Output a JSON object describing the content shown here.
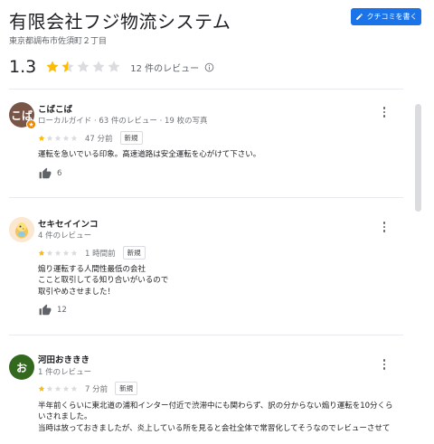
{
  "header": {
    "title": "有限会社フジ物流システム",
    "address": "東京都調布市佐須町２丁目",
    "write_review_label": "クチコミを書く",
    "average_rating": "1.3",
    "rating_value": 1.3,
    "rating_max": 5,
    "review_count_label": "12 件のレビュー"
  },
  "reviews": [
    {
      "avatar_text": "こば",
      "avatar_color": "#795548",
      "author": "こばこば",
      "meta": "ローカルガイド · 63 件のレビュー · 19 枚の写真",
      "stars": 1,
      "time": "47 分前",
      "badge": "新規",
      "text_lines": [
        "運転を急いでいる印象。高速道路は安全運転を心がけて下さい。"
      ],
      "likes": "6"
    },
    {
      "avatar_text": "",
      "avatar_color": "#fce8d0",
      "author": "セキセイインコ",
      "meta": "4 件のレビュー",
      "stars": 1,
      "time": "1 時間前",
      "badge": "新規",
      "text_lines": [
        "煽り運転する人間性最低の会社",
        "ここと取引してる知り合いがいるので",
        "取引やめさせました！"
      ],
      "likes": "12"
    },
    {
      "avatar_text": "お",
      "avatar_color": "#33691e",
      "author": "河田おききき",
      "meta": "1 件のレビュー",
      "stars": 1,
      "time": "7 分前",
      "badge": "新規",
      "text_lines": [
        "半年前くらいに東北道の浦和インター付近で渋滞中にも関わらず、訳の分からない煽り運転を10分くらいされました。",
        "当時は放っておきましたが、炎上している所を見ると会社全体で常習化してそうなのでレビューさせて"
      ],
      "likes": ""
    }
  ],
  "colors": {
    "accent": "#1a73e8",
    "star_filled": "#fbbc04",
    "star_empty": "#dadce0"
  },
  "icons": [
    "pencil-icon",
    "star-icon",
    "info-icon",
    "thumb-up-icon",
    "more-vert-icon",
    "local-guide-badge-icon",
    "bird-avatar-icon"
  ]
}
